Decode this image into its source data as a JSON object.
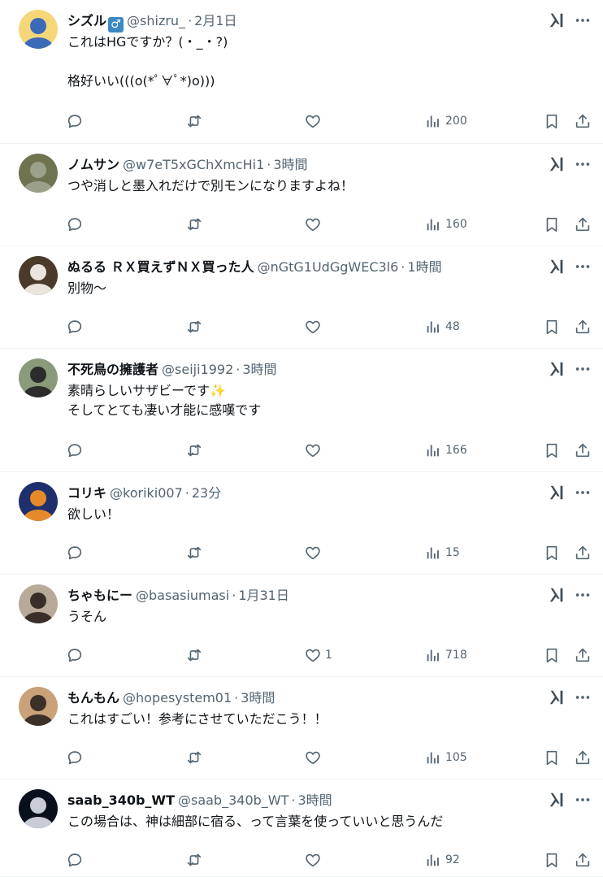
{
  "tweets": [
    {
      "name": "シズル",
      "gender_badge": "♂",
      "handle": "@shizru_",
      "time": "2月1日",
      "text": "これはHGですか？(・_・?)\n\n格好いい(((o(*ﾟ∀ﾟ*)o)))",
      "replies": "",
      "retweets": "",
      "likes": "",
      "views": "200",
      "avatar_colors": [
        "#f5d77a",
        "#3b6bb8"
      ]
    },
    {
      "name": "ノムサン",
      "gender_badge": "",
      "handle": "@w7eT5xGChXmcHi1",
      "time": "3時間",
      "text": "つや消しと墨入れだけで別モンになりますよね！",
      "replies": "",
      "retweets": "",
      "likes": "",
      "views": "160",
      "avatar_colors": [
        "#6f7350",
        "#9aa089"
      ]
    },
    {
      "name": "ぬるる ＲＸ買えずＮＸ買った人",
      "gender_badge": "",
      "handle": "@nGtG1UdGgWEC3l6",
      "time": "1時間",
      "text": "別物～",
      "replies": "",
      "retweets": "",
      "likes": "",
      "views": "48",
      "avatar_colors": [
        "#4b3a2a",
        "#e9e5dc"
      ]
    },
    {
      "name": "不死鳥の擁護者",
      "gender_badge": "",
      "handle": "@seiji1992",
      "time": "3時間",
      "text": "素晴らしいサザビーです✨\nそしてとても凄い才能に感嘆です",
      "replies": "",
      "retweets": "",
      "likes": "",
      "views": "166",
      "avatar_colors": [
        "#8a9a7a",
        "#2c2c2c"
      ]
    },
    {
      "name": "コリキ",
      "gender_badge": "",
      "handle": "@koriki007",
      "time": "23分",
      "text": "欲しい！",
      "replies": "",
      "retweets": "",
      "likes": "",
      "views": "15",
      "avatar_colors": [
        "#1e2f6b",
        "#e58a2a"
      ]
    },
    {
      "name": "ちゃもにー",
      "gender_badge": "",
      "handle": "@basasiumasi",
      "time": "1月31日",
      "text": "うそん",
      "replies": "",
      "retweets": "",
      "likes": "1",
      "views": "718",
      "avatar_colors": [
        "#b7aa98",
        "#3a2f28"
      ]
    },
    {
      "name": "もんもん",
      "gender_badge": "",
      "handle": "@hopesystem01",
      "time": "3時間",
      "text": "これはすごい！参考にさせていただこう！！",
      "replies": "",
      "retweets": "",
      "likes": "",
      "views": "105",
      "avatar_colors": [
        "#c9a27a",
        "#3d3028"
      ]
    },
    {
      "name": "saab_340b_WT",
      "gender_badge": "",
      "handle": "@saab_340b_WT",
      "time": "3時間",
      "text": "この場合は、神は細部に宿る、って言葉を使っていいと思うんだ",
      "replies": "",
      "retweets": "",
      "likes": "",
      "views": "92",
      "avatar_colors": [
        "#0a0f1c",
        "#c8ccd6"
      ]
    }
  ]
}
